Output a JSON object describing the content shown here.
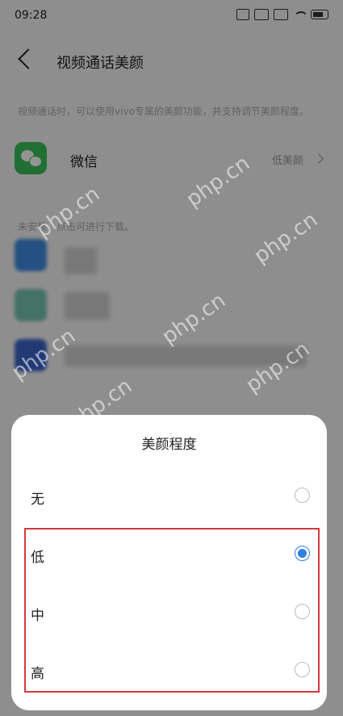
{
  "status_bar": {
    "time": "09:28"
  },
  "header": {
    "title": "视频通话美颜"
  },
  "description": "视频通话时，可以使用vivo专属的美颜功能，并支持调节美颜程度。",
  "app": {
    "name": "微信",
    "value": "低美颜"
  },
  "section_label": "未安装，点击可进行下载。",
  "watermark": "php.cn",
  "sheet": {
    "title": "美颜程度",
    "options": [
      {
        "label": "无",
        "checked": false
      },
      {
        "label": "低",
        "checked": true
      },
      {
        "label": "中",
        "checked": false
      },
      {
        "label": "高",
        "checked": false
      }
    ]
  },
  "colors": {
    "accent": "#2e7fe6",
    "highlight": "#d23a3a",
    "wechat": "#3cc05a"
  }
}
